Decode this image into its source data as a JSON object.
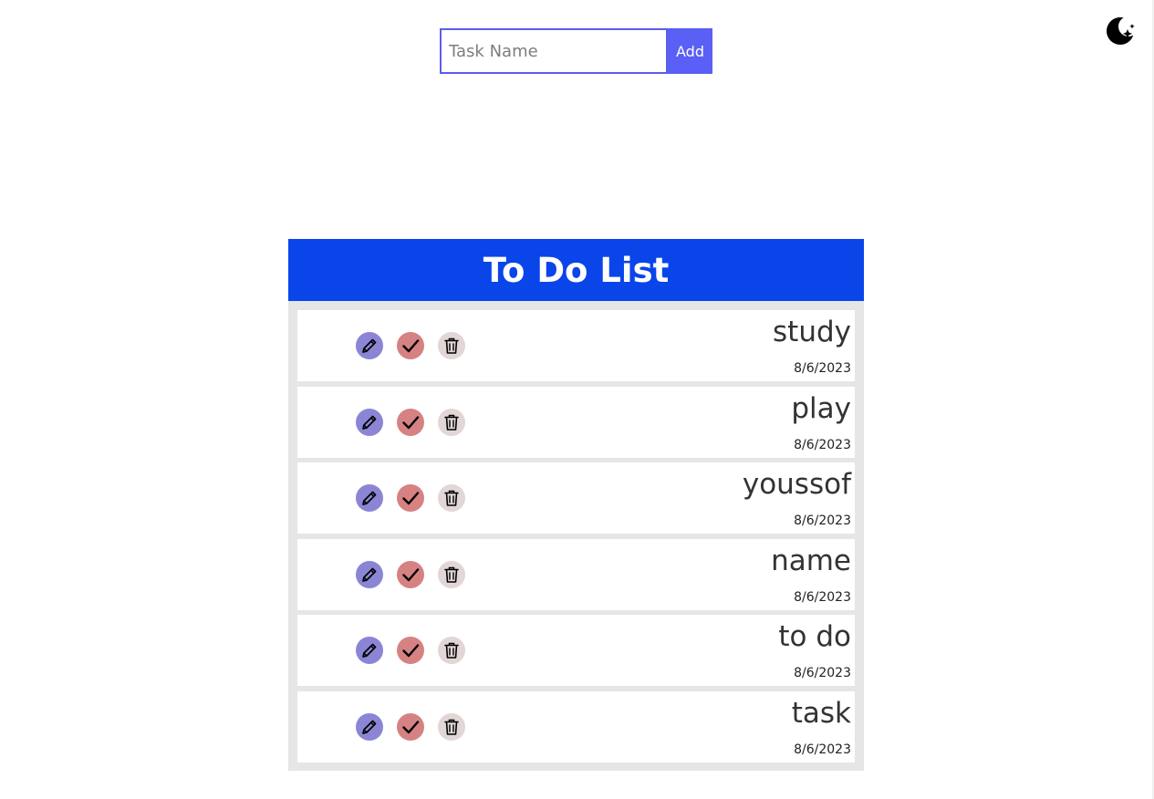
{
  "form": {
    "input_placeholder": "Task Name",
    "input_value": "",
    "add_label": "Add"
  },
  "theme_toggle": {
    "icon": "moon-stars-icon"
  },
  "list": {
    "title": "To Do List",
    "items": [
      {
        "name": "study",
        "date": "8/6/2023"
      },
      {
        "name": "play",
        "date": "8/6/2023"
      },
      {
        "name": "youssof",
        "date": "8/6/2023"
      },
      {
        "name": "name",
        "date": "8/6/2023"
      },
      {
        "name": "to do",
        "date": "8/6/2023"
      },
      {
        "name": "task",
        "date": "8/6/2023"
      }
    ],
    "item_actions": [
      "pencil-icon",
      "check-icon",
      "trash-icon"
    ]
  },
  "colors": {
    "header": "#0a45e9",
    "add_button": "#5a5ff5",
    "edit": "#8b85d5",
    "done": "#d68282",
    "delete": "#e2d6d6"
  }
}
